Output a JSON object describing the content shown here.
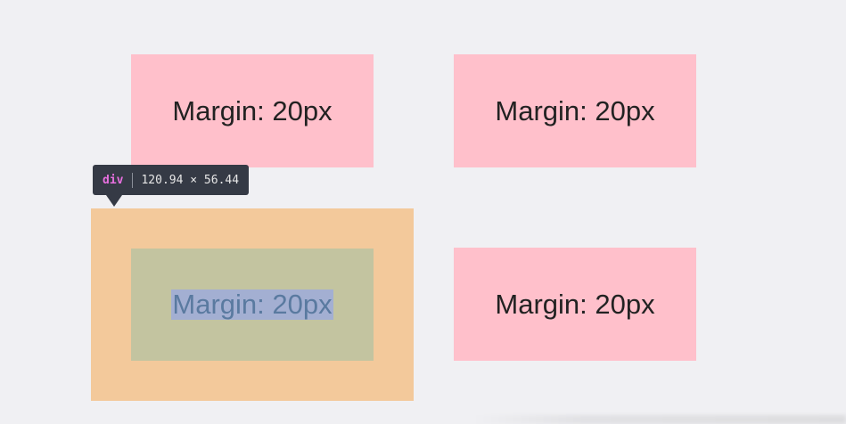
{
  "boxes": [
    {
      "label": "Margin: 20px"
    },
    {
      "label": "Margin: 20px"
    },
    {
      "label": "Margin: 20px"
    },
    {
      "label": "Margin: 20px"
    }
  ],
  "inspector_tooltip": {
    "tag": "div",
    "dimensions": "120.94 × 56.44"
  },
  "colors": {
    "page_background": "#f0f0f3",
    "box_fill": "#ffc0cb",
    "margin_highlight": "#f3c99b",
    "content_highlight": "#c3c4a0",
    "text_selection": "#a3afd2",
    "tooltip_background": "#353a45",
    "tooltip_tag": "#e870e0"
  }
}
